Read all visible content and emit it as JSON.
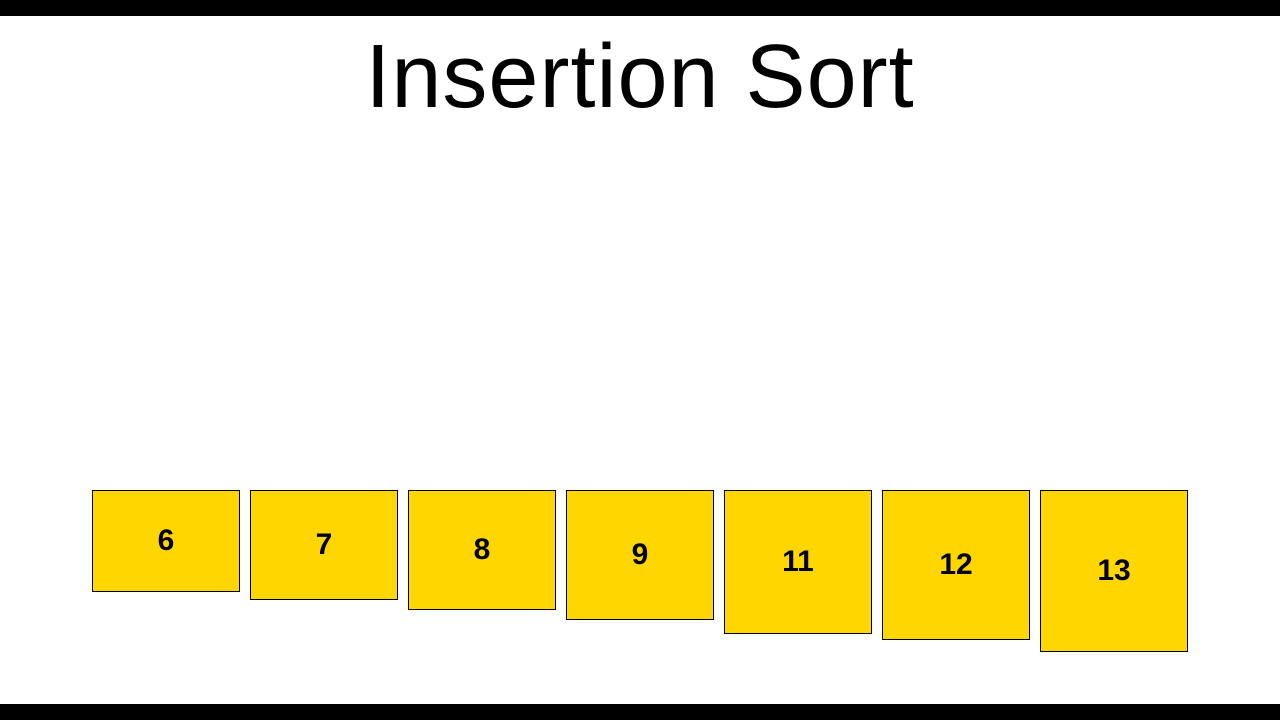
{
  "title": "Insertion Sort",
  "array": {
    "items": [
      {
        "value": "6"
      },
      {
        "value": "7"
      },
      {
        "value": "8"
      },
      {
        "value": "9"
      },
      {
        "value": "11"
      },
      {
        "value": "12"
      },
      {
        "value": "13"
      }
    ]
  },
  "colors": {
    "cell_fill": "#ffd600",
    "cell_border": "#000000",
    "background": "#ffffff",
    "letterbox": "#000000"
  }
}
